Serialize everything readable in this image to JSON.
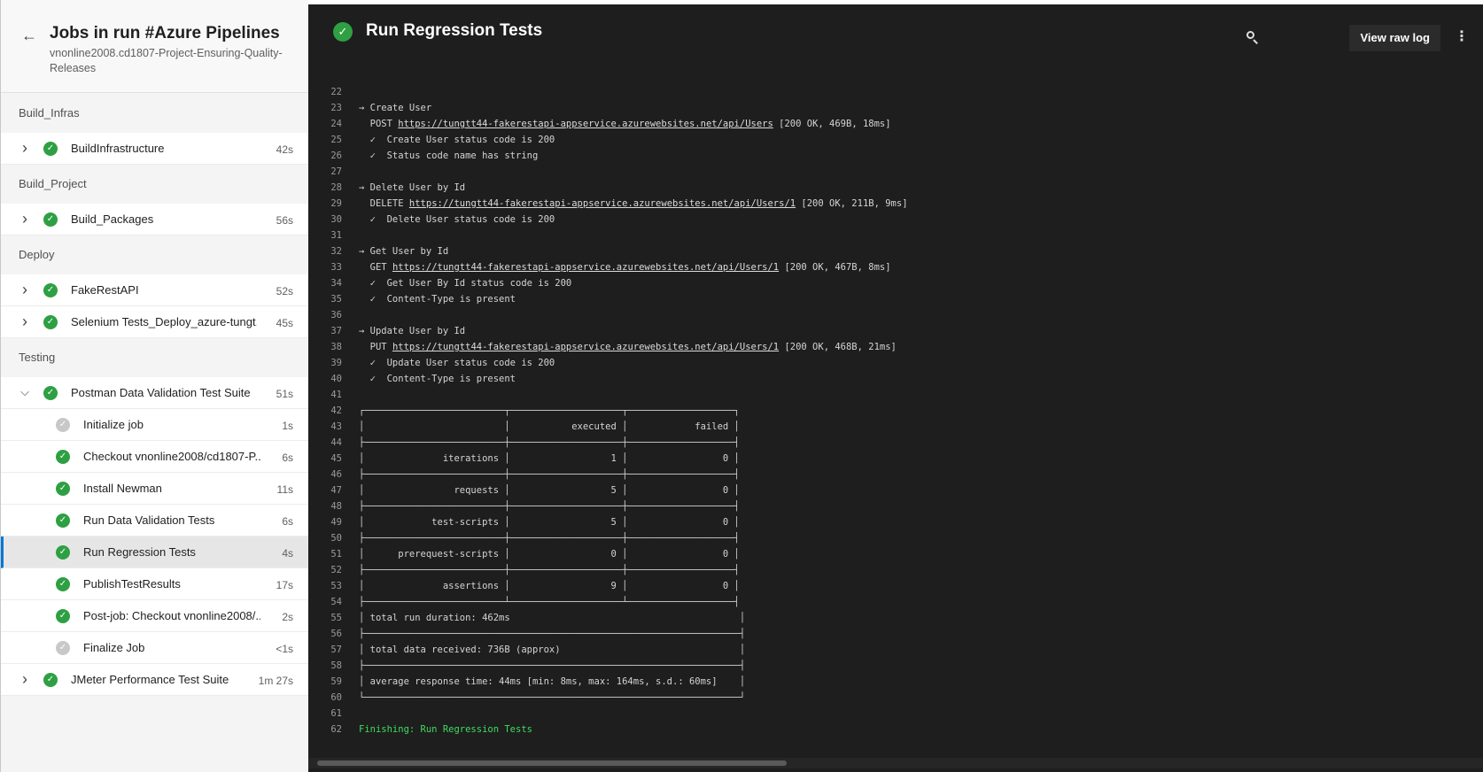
{
  "header": {
    "title": "Jobs in run #Azure Pipelines",
    "subtitle": "vnonline2008.cd1807-Project-Ensuring-Quality-Releases"
  },
  "stages": [
    {
      "name": "Build_Infras",
      "jobs": [
        {
          "name": "BuildInfrastructure",
          "duration": "42s",
          "status": "success",
          "expanded": false
        }
      ]
    },
    {
      "name": "Build_Project",
      "jobs": [
        {
          "name": "Build_Packages",
          "duration": "56s",
          "status": "success",
          "expanded": false
        }
      ]
    },
    {
      "name": "Deploy",
      "jobs": [
        {
          "name": "FakeRestAPI",
          "duration": "52s",
          "status": "success",
          "expanded": false
        },
        {
          "name": "Selenium Tests_Deploy_azure-tungt...",
          "duration": "45s",
          "status": "success",
          "expanded": false
        }
      ]
    },
    {
      "name": "Testing",
      "jobs": [
        {
          "name": "Postman Data Validation Test Suite",
          "duration": "51s",
          "status": "success",
          "expanded": true,
          "steps": [
            {
              "name": "Initialize job",
              "duration": "1s",
              "status": "skipped"
            },
            {
              "name": "Checkout vnonline2008/cd1807-P...",
              "duration": "6s",
              "status": "success"
            },
            {
              "name": "Install Newman",
              "duration": "11s",
              "status": "success"
            },
            {
              "name": "Run Data Validation Tests",
              "duration": "6s",
              "status": "success"
            },
            {
              "name": "Run Regression Tests",
              "duration": "4s",
              "status": "success",
              "selected": true
            },
            {
              "name": "PublishTestResults",
              "duration": "17s",
              "status": "success"
            },
            {
              "name": "Post-job: Checkout vnonline2008/...",
              "duration": "2s",
              "status": "success"
            },
            {
              "name": "Finalize Job",
              "duration": "<1s",
              "status": "skipped"
            }
          ]
        },
        {
          "name": "JMeter Performance Test Suite",
          "duration": "1m 27s",
          "status": "success",
          "expanded": false
        }
      ]
    }
  ],
  "log": {
    "title": "Run Regression Tests",
    "raw_button": "View raw log",
    "lines": [
      {
        "n": "22",
        "t": ""
      },
      {
        "n": "23",
        "t": "→ Create User"
      },
      {
        "n": "24",
        "pre": "  POST ",
        "url": "https://tungtt44-fakerestapi-appservice.azurewebsites.net/api/Users",
        "post": " [200 OK, 469B, 18ms]"
      },
      {
        "n": "25",
        "t": "  ✓  Create User status code is 200"
      },
      {
        "n": "26",
        "t": "  ✓  Status code name has string"
      },
      {
        "n": "27",
        "t": ""
      },
      {
        "n": "28",
        "t": "→ Delete User by Id"
      },
      {
        "n": "29",
        "pre": "  DELETE ",
        "url": "https://tungtt44-fakerestapi-appservice.azurewebsites.net/api/Users/1",
        "post": " [200 OK, 211B, 9ms]"
      },
      {
        "n": "30",
        "t": "  ✓  Delete User status code is 200"
      },
      {
        "n": "31",
        "t": ""
      },
      {
        "n": "32",
        "t": "→ Get User by Id"
      },
      {
        "n": "33",
        "pre": "  GET ",
        "url": "https://tungtt44-fakerestapi-appservice.azurewebsites.net/api/Users/1",
        "post": " [200 OK, 467B, 8ms]"
      },
      {
        "n": "34",
        "t": "  ✓  Get User By Id status code is 200"
      },
      {
        "n": "35",
        "t": "  ✓  Content-Type is present"
      },
      {
        "n": "36",
        "t": ""
      },
      {
        "n": "37",
        "t": "→ Update User by Id"
      },
      {
        "n": "38",
        "pre": "  PUT ",
        "url": "https://tungtt44-fakerestapi-appservice.azurewebsites.net/api/Users/1",
        "post": " [200 OK, 468B, 21ms]"
      },
      {
        "n": "39",
        "t": "  ✓  Update User status code is 200"
      },
      {
        "n": "40",
        "t": "  ✓  Content-Type is present"
      },
      {
        "n": "41",
        "t": ""
      },
      {
        "n": "42",
        "t": "┌─────────────────────────┬────────────────────┬───────────────────┐"
      },
      {
        "n": "43",
        "t": "│                         │           executed │            failed │"
      },
      {
        "n": "44",
        "t": "├─────────────────────────┼────────────────────┼───────────────────┤"
      },
      {
        "n": "45",
        "t": "│              iterations │                  1 │                 0 │"
      },
      {
        "n": "46",
        "t": "├─────────────────────────┼────────────────────┼───────────────────┤"
      },
      {
        "n": "47",
        "t": "│                requests │                  5 │                 0 │"
      },
      {
        "n": "48",
        "t": "├─────────────────────────┼────────────────────┼───────────────────┤"
      },
      {
        "n": "49",
        "t": "│            test-scripts │                  5 │                 0 │"
      },
      {
        "n": "50",
        "t": "├─────────────────────────┼────────────────────┼───────────────────┤"
      },
      {
        "n": "51",
        "t": "│      prerequest-scripts │                  0 │                 0 │"
      },
      {
        "n": "52",
        "t": "├─────────────────────────┼────────────────────┼───────────────────┤"
      },
      {
        "n": "53",
        "t": "│              assertions │                  9 │                 0 │"
      },
      {
        "n": "54",
        "t": "├─────────────────────────┴────────────────────┴───────────────────┤"
      },
      {
        "n": "55",
        "t": "│ total run duration: 462ms                                         │"
      },
      {
        "n": "56",
        "t": "├───────────────────────────────────────────────────────────────────┤"
      },
      {
        "n": "57",
        "t": "│ total data received: 736B (approx)                                │"
      },
      {
        "n": "58",
        "t": "├───────────────────────────────────────────────────────────────────┤"
      },
      {
        "n": "59",
        "t": "│ average response time: 44ms [min: 8ms, max: 164ms, s.d.: 60ms]    │"
      },
      {
        "n": "60",
        "t": "└───────────────────────────────────────────────────────────────────┘"
      },
      {
        "n": "61",
        "t": ""
      },
      {
        "n": "62",
        "t": "Finishing: Run Regression Tests",
        "color": "green"
      }
    ]
  },
  "colors": {
    "success": "#2ea043",
    "skipped": "#c8c8c8",
    "selected_accent": "#0078d4",
    "log_bg": "#1e1e1e",
    "finish_text": "#3fdc5f"
  },
  "icons": {
    "back": "arrow-left-icon",
    "search": "search-icon",
    "more": "more-vertical-icon",
    "expand": "chevron-right-icon",
    "collapse": "chevron-down-icon",
    "success": "check-circle-icon"
  }
}
